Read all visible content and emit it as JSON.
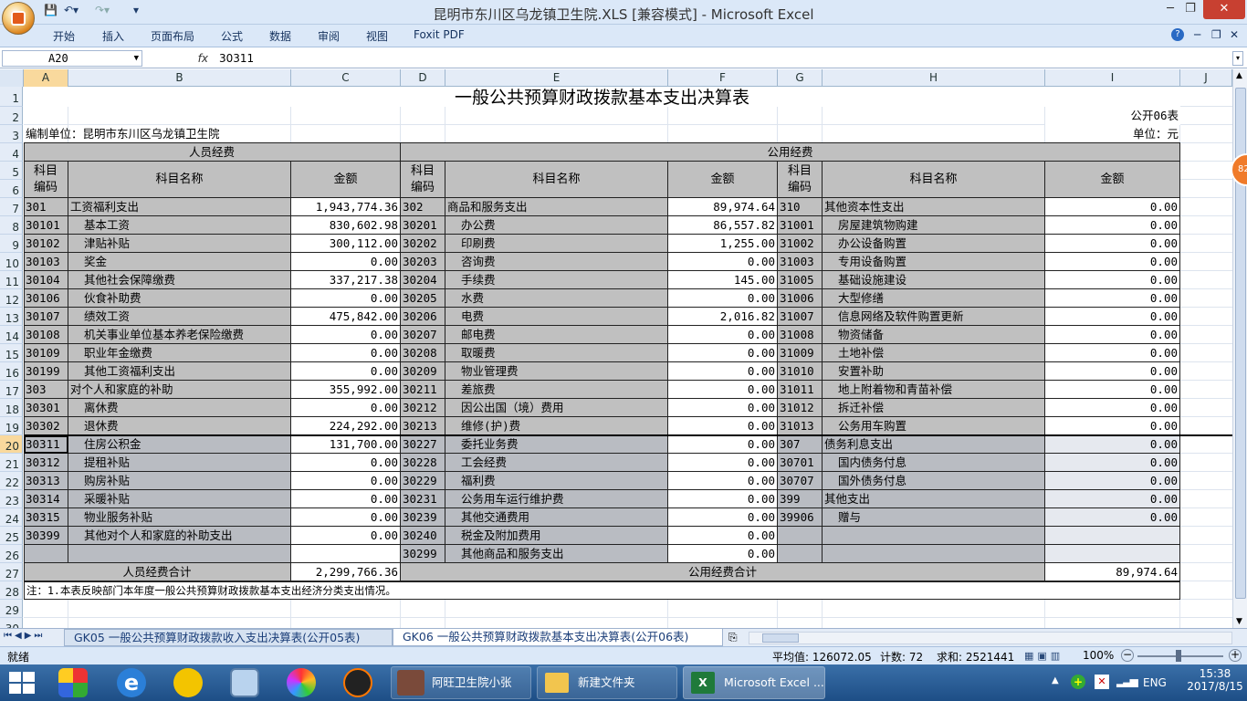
{
  "window": {
    "title": "昆明市东川区乌龙镇卫生院.XLS  [兼容模式] - Microsoft Excel"
  },
  "ribbon": {
    "tabs": [
      "开始",
      "插入",
      "页面布局",
      "公式",
      "数据",
      "审阅",
      "视图",
      "Foxit PDF"
    ]
  },
  "formula_bar": {
    "name_box": "A20",
    "fx": "fx",
    "content": "30311"
  },
  "columns": [
    "A",
    "B",
    "C",
    "D",
    "E",
    "F",
    "G",
    "H",
    "I",
    "J"
  ],
  "sheet": {
    "title": "一般公共预算财政拨款基本支出决算表",
    "form_no": "公开06表",
    "unit_label": "编制单位：昆明市东川区乌龙镇卫生院",
    "currency": "单位：元",
    "group_left": "人员经费",
    "group_right": "公用经费",
    "hdr_code": "科目\n编码",
    "hdr_name": "科目名称",
    "hdr_amount": "金额",
    "rows": [
      {
        "r": "7",
        "a": "301",
        "b": "工资福利支出",
        "c": "1,943,774.36",
        "d": "302",
        "e": "商品和服务支出",
        "f": "89,974.64",
        "g": "310",
        "h": "其他资本性支出",
        "i": "0.00"
      },
      {
        "r": "8",
        "a": "30101",
        "b": "  基本工资",
        "c": "830,602.98",
        "d": "30201",
        "e": "  办公费",
        "f": "86,557.82",
        "g": "31001",
        "h": "  房屋建筑物购建",
        "i": "0.00"
      },
      {
        "r": "9",
        "a": "30102",
        "b": "  津贴补贴",
        "c": "300,112.00",
        "d": "30202",
        "e": "  印刷费",
        "f": "1,255.00",
        "g": "31002",
        "h": "  办公设备购置",
        "i": "0.00"
      },
      {
        "r": "10",
        "a": "30103",
        "b": "  奖金",
        "c": "0.00",
        "d": "30203",
        "e": "  咨询费",
        "f": "0.00",
        "g": "31003",
        "h": "  专用设备购置",
        "i": "0.00"
      },
      {
        "r": "11",
        "a": "30104",
        "b": "  其他社会保障缴费",
        "c": "337,217.38",
        "d": "30204",
        "e": "  手续费",
        "f": "145.00",
        "g": "31005",
        "h": "  基础设施建设",
        "i": "0.00"
      },
      {
        "r": "12",
        "a": "30106",
        "b": "  伙食补助费",
        "c": "0.00",
        "d": "30205",
        "e": "  水费",
        "f": "0.00",
        "g": "31006",
        "h": "  大型修缮",
        "i": "0.00"
      },
      {
        "r": "13",
        "a": "30107",
        "b": "  绩效工资",
        "c": "475,842.00",
        "d": "30206",
        "e": "  电费",
        "f": "2,016.82",
        "g": "31007",
        "h": "  信息网络及软件购置更新",
        "i": "0.00"
      },
      {
        "r": "14",
        "a": "30108",
        "b": "  机关事业单位基本养老保险缴费",
        "c": "0.00",
        "d": "30207",
        "e": "  邮电费",
        "f": "0.00",
        "g": "31008",
        "h": "  物资储备",
        "i": "0.00"
      },
      {
        "r": "15",
        "a": "30109",
        "b": "  职业年金缴费",
        "c": "0.00",
        "d": "30208",
        "e": "  取暖费",
        "f": "0.00",
        "g": "31009",
        "h": "  土地补偿",
        "i": "0.00"
      },
      {
        "r": "16",
        "a": "30199",
        "b": "  其他工资福利支出",
        "c": "0.00",
        "d": "30209",
        "e": "  物业管理费",
        "f": "0.00",
        "g": "31010",
        "h": "  安置补助",
        "i": "0.00"
      },
      {
        "r": "17",
        "a": "303",
        "b": "对个人和家庭的补助",
        "c": "355,992.00",
        "d": "30211",
        "e": "  差旅费",
        "f": "0.00",
        "g": "31011",
        "h": "  地上附着物和青苗补偿",
        "i": "0.00"
      },
      {
        "r": "18",
        "a": "30301",
        "b": "  离休费",
        "c": "0.00",
        "d": "30212",
        "e": "  因公出国（境）费用",
        "f": "0.00",
        "g": "31012",
        "h": "  拆迁补偿",
        "i": "0.00"
      },
      {
        "r": "19",
        "a": "30302",
        "b": "  退休费",
        "c": "224,292.00",
        "d": "30213",
        "e": "  维修(护)费",
        "f": "0.00",
        "g": "31013",
        "h": "  公务用车购置",
        "i": "0.00"
      },
      {
        "r": "20",
        "a": "30311",
        "b": "  住房公积金",
        "c": "131,700.00",
        "d": "30227",
        "e": "  委托业务费",
        "f": "0.00",
        "g": "307",
        "h": "债务利息支出",
        "i": "0.00"
      },
      {
        "r": "21",
        "a": "30312",
        "b": "  提租补贴",
        "c": "0.00",
        "d": "30228",
        "e": "  工会经费",
        "f": "0.00",
        "g": "30701",
        "h": "  国内债务付息",
        "i": "0.00"
      },
      {
        "r": "22",
        "a": "30313",
        "b": "  购房补贴",
        "c": "0.00",
        "d": "30229",
        "e": "  福利费",
        "f": "0.00",
        "g": "30707",
        "h": "  国外债务付息",
        "i": "0.00"
      },
      {
        "r": "23",
        "a": "30314",
        "b": "  采暖补贴",
        "c": "0.00",
        "d": "30231",
        "e": "  公务用车运行维护费",
        "f": "0.00",
        "g": "399",
        "h": "其他支出",
        "i": "0.00"
      },
      {
        "r": "24",
        "a": "30315",
        "b": "  物业服务补贴",
        "c": "0.00",
        "d": "30239",
        "e": "  其他交通费用",
        "f": "0.00",
        "g": "39906",
        "h": "  赠与",
        "i": "0.00"
      },
      {
        "r": "25",
        "a": "30399",
        "b": "  其他对个人和家庭的补助支出",
        "c": "0.00",
        "d": "30240",
        "e": "  税金及附加费用",
        "f": "0.00",
        "g": "",
        "h": "",
        "i": ""
      },
      {
        "r": "26",
        "a": "",
        "b": "",
        "c": "",
        "d": "30299",
        "e": "  其他商品和服务支出",
        "f": "0.00",
        "g": "",
        "h": "",
        "i": ""
      }
    ],
    "total_left_label": "人员经费合计",
    "total_left": "2,299,766.36",
    "total_right_label": "公用经费合计",
    "total_right": "89,974.64",
    "note": "注：1.本表反映部门本年度一般公共预算财政拨款基本支出经济分类支出情况。",
    "row_numbers": [
      "1",
      "2",
      "3",
      "4",
      "5",
      "6",
      "7",
      "8",
      "9",
      "10",
      "11",
      "12",
      "13",
      "14",
      "15",
      "16",
      "17",
      "18",
      "19",
      "20",
      "21",
      "22",
      "23",
      "24",
      "25",
      "26",
      "27",
      "28",
      "29",
      "30"
    ]
  },
  "sheet_tabs": [
    "GK05 一般公共预算财政拨款收入支出决算表(公开05表)",
    "GK06 一般公共预算财政拨款基本支出决算表(公开06表)"
  ],
  "status": {
    "ready": "就绪",
    "average": "平均值: 126072.05",
    "count": "计数: 72",
    "sum": "求和: 2521441",
    "zoom": "100%"
  },
  "taskbar": {
    "tasks": [
      "阿旺卫生院小张",
      "新建文件夹",
      "Microsoft Excel ..."
    ],
    "lang": "ENG",
    "time": "15:38",
    "date": "2017/8/15"
  },
  "side_badge": "82"
}
